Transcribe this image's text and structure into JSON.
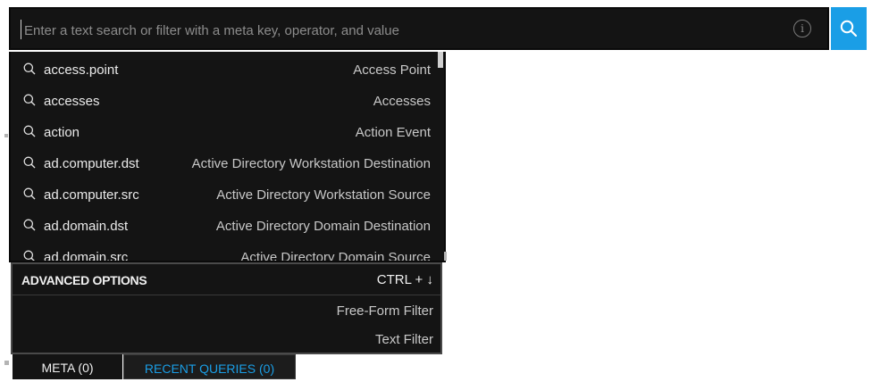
{
  "search": {
    "placeholder": "Enter a text search or filter with a meta key, operator, and value",
    "info_icon": "info-icon",
    "button_icon": "search-icon",
    "accent_color": "#1a9ee6"
  },
  "suggestions": [
    {
      "key": "access.point",
      "description": "Access Point"
    },
    {
      "key": "accesses",
      "description": "Accesses"
    },
    {
      "key": "action",
      "description": "Action Event"
    },
    {
      "key": "ad.computer.dst",
      "description": "Active Directory Workstation Destination"
    },
    {
      "key": "ad.computer.src",
      "description": "Active Directory Workstation Source"
    },
    {
      "key": "ad.domain.dst",
      "description": "Active Directory Domain Destination"
    },
    {
      "key": "ad.domain.src",
      "description": "Active Directory Domain Source"
    }
  ],
  "advanced": {
    "title": "ADVANCED OPTIONS",
    "shortcut": "CTRL + ↓",
    "items": [
      "Free-Form Filter",
      "Text Filter"
    ]
  },
  "tabs": {
    "meta": "META (0)",
    "recent": "RECENT QUERIES (0)"
  }
}
